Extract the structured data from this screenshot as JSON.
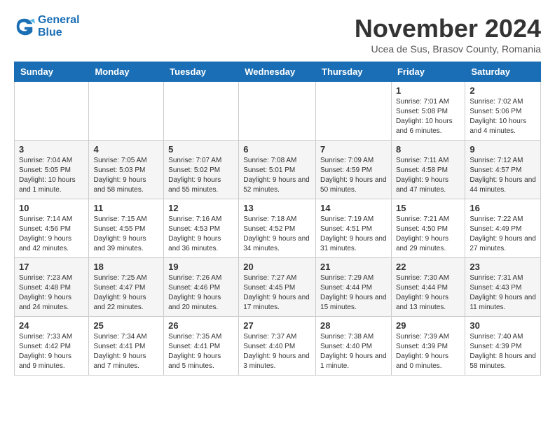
{
  "header": {
    "logo_line1": "General",
    "logo_line2": "Blue",
    "month_title": "November 2024",
    "location": "Ucea de Sus, Brasov County, Romania"
  },
  "weekdays": [
    "Sunday",
    "Monday",
    "Tuesday",
    "Wednesday",
    "Thursday",
    "Friday",
    "Saturday"
  ],
  "weeks": [
    [
      {
        "day": "",
        "info": ""
      },
      {
        "day": "",
        "info": ""
      },
      {
        "day": "",
        "info": ""
      },
      {
        "day": "",
        "info": ""
      },
      {
        "day": "",
        "info": ""
      },
      {
        "day": "1",
        "info": "Sunrise: 7:01 AM\nSunset: 5:08 PM\nDaylight: 10 hours and 6 minutes."
      },
      {
        "day": "2",
        "info": "Sunrise: 7:02 AM\nSunset: 5:06 PM\nDaylight: 10 hours and 4 minutes."
      }
    ],
    [
      {
        "day": "3",
        "info": "Sunrise: 7:04 AM\nSunset: 5:05 PM\nDaylight: 10 hours and 1 minute."
      },
      {
        "day": "4",
        "info": "Sunrise: 7:05 AM\nSunset: 5:03 PM\nDaylight: 9 hours and 58 minutes."
      },
      {
        "day": "5",
        "info": "Sunrise: 7:07 AM\nSunset: 5:02 PM\nDaylight: 9 hours and 55 minutes."
      },
      {
        "day": "6",
        "info": "Sunrise: 7:08 AM\nSunset: 5:01 PM\nDaylight: 9 hours and 52 minutes."
      },
      {
        "day": "7",
        "info": "Sunrise: 7:09 AM\nSunset: 4:59 PM\nDaylight: 9 hours and 50 minutes."
      },
      {
        "day": "8",
        "info": "Sunrise: 7:11 AM\nSunset: 4:58 PM\nDaylight: 9 hours and 47 minutes."
      },
      {
        "day": "9",
        "info": "Sunrise: 7:12 AM\nSunset: 4:57 PM\nDaylight: 9 hours and 44 minutes."
      }
    ],
    [
      {
        "day": "10",
        "info": "Sunrise: 7:14 AM\nSunset: 4:56 PM\nDaylight: 9 hours and 42 minutes."
      },
      {
        "day": "11",
        "info": "Sunrise: 7:15 AM\nSunset: 4:55 PM\nDaylight: 9 hours and 39 minutes."
      },
      {
        "day": "12",
        "info": "Sunrise: 7:16 AM\nSunset: 4:53 PM\nDaylight: 9 hours and 36 minutes."
      },
      {
        "day": "13",
        "info": "Sunrise: 7:18 AM\nSunset: 4:52 PM\nDaylight: 9 hours and 34 minutes."
      },
      {
        "day": "14",
        "info": "Sunrise: 7:19 AM\nSunset: 4:51 PM\nDaylight: 9 hours and 31 minutes."
      },
      {
        "day": "15",
        "info": "Sunrise: 7:21 AM\nSunset: 4:50 PM\nDaylight: 9 hours and 29 minutes."
      },
      {
        "day": "16",
        "info": "Sunrise: 7:22 AM\nSunset: 4:49 PM\nDaylight: 9 hours and 27 minutes."
      }
    ],
    [
      {
        "day": "17",
        "info": "Sunrise: 7:23 AM\nSunset: 4:48 PM\nDaylight: 9 hours and 24 minutes."
      },
      {
        "day": "18",
        "info": "Sunrise: 7:25 AM\nSunset: 4:47 PM\nDaylight: 9 hours and 22 minutes."
      },
      {
        "day": "19",
        "info": "Sunrise: 7:26 AM\nSunset: 4:46 PM\nDaylight: 9 hours and 20 minutes."
      },
      {
        "day": "20",
        "info": "Sunrise: 7:27 AM\nSunset: 4:45 PM\nDaylight: 9 hours and 17 minutes."
      },
      {
        "day": "21",
        "info": "Sunrise: 7:29 AM\nSunset: 4:44 PM\nDaylight: 9 hours and 15 minutes."
      },
      {
        "day": "22",
        "info": "Sunrise: 7:30 AM\nSunset: 4:44 PM\nDaylight: 9 hours and 13 minutes."
      },
      {
        "day": "23",
        "info": "Sunrise: 7:31 AM\nSunset: 4:43 PM\nDaylight: 9 hours and 11 minutes."
      }
    ],
    [
      {
        "day": "24",
        "info": "Sunrise: 7:33 AM\nSunset: 4:42 PM\nDaylight: 9 hours and 9 minutes."
      },
      {
        "day": "25",
        "info": "Sunrise: 7:34 AM\nSunset: 4:41 PM\nDaylight: 9 hours and 7 minutes."
      },
      {
        "day": "26",
        "info": "Sunrise: 7:35 AM\nSunset: 4:41 PM\nDaylight: 9 hours and 5 minutes."
      },
      {
        "day": "27",
        "info": "Sunrise: 7:37 AM\nSunset: 4:40 PM\nDaylight: 9 hours and 3 minutes."
      },
      {
        "day": "28",
        "info": "Sunrise: 7:38 AM\nSunset: 4:40 PM\nDaylight: 9 hours and 1 minute."
      },
      {
        "day": "29",
        "info": "Sunrise: 7:39 AM\nSunset: 4:39 PM\nDaylight: 9 hours and 0 minutes."
      },
      {
        "day": "30",
        "info": "Sunrise: 7:40 AM\nSunset: 4:39 PM\nDaylight: 8 hours and 58 minutes."
      }
    ]
  ]
}
